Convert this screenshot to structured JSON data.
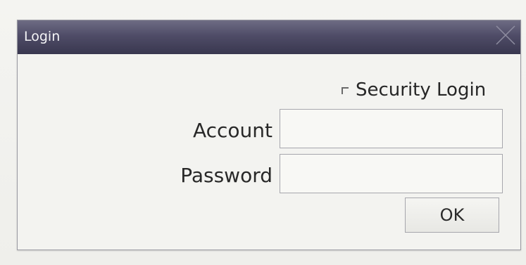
{
  "dialog": {
    "title": "Login",
    "close_icon": "close-icon"
  },
  "security_login": {
    "label": "Security Login",
    "checked": false
  },
  "account": {
    "label": "Account",
    "value": "",
    "placeholder": ""
  },
  "password": {
    "label": "Password",
    "value": "",
    "placeholder": ""
  },
  "ok_button": {
    "label": "OK"
  },
  "colors": {
    "titlebar_top": "#6e6c84",
    "titlebar_bottom": "#39374f",
    "dialog_background": "#f3f3f0",
    "text": "#282828"
  }
}
